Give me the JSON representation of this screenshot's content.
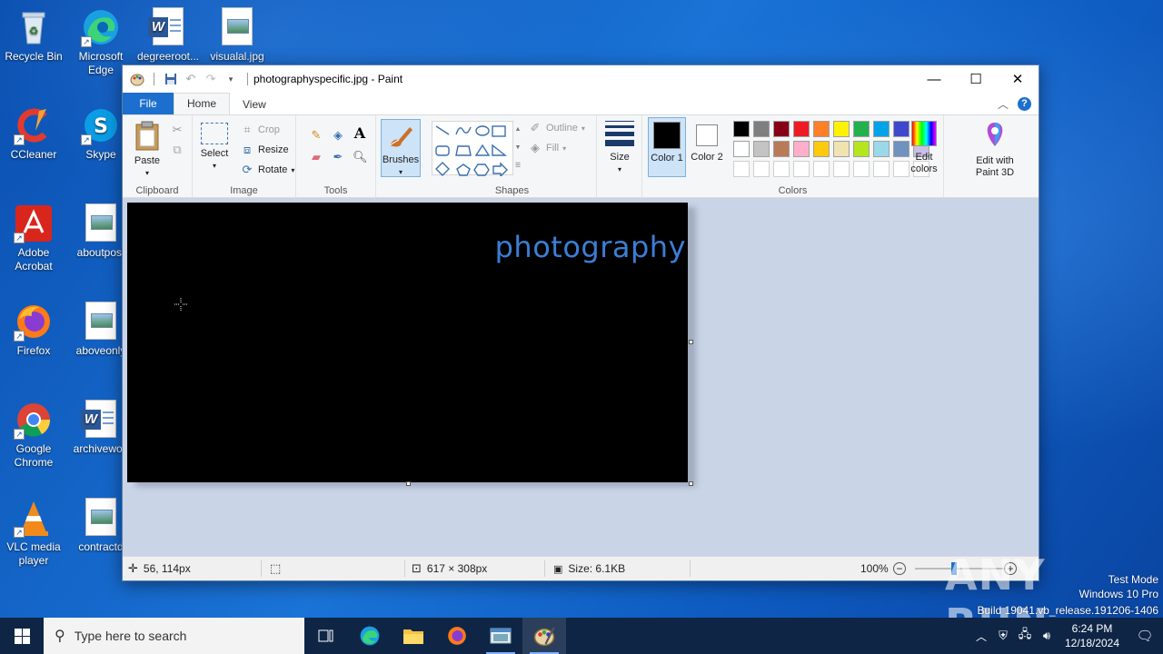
{
  "desktop": {
    "icons": [
      {
        "label": "Recycle Bin",
        "icon": "recycle-bin-icon"
      },
      {
        "label": "Microsoft Edge",
        "icon": "edge-icon"
      },
      {
        "label": "degreeroot...",
        "icon": "word-doc-icon"
      },
      {
        "label": "visualal.jpg",
        "icon": "image-file-icon"
      },
      {
        "label": "CCleaner",
        "icon": "ccleaner-icon"
      },
      {
        "label": "Skype",
        "icon": "skype-icon"
      },
      {
        "label": "Adobe Acrobat",
        "icon": "acrobat-icon"
      },
      {
        "label": "aboutpost",
        "icon": "image-file-icon"
      },
      {
        "label": "Firefox",
        "icon": "firefox-icon"
      },
      {
        "label": "aboveonly",
        "icon": "image-file-icon"
      },
      {
        "label": "Google Chrome",
        "icon": "chrome-icon"
      },
      {
        "label": "archivewou",
        "icon": "word-doc-icon"
      },
      {
        "label": "VLC media player",
        "icon": "vlc-icon"
      },
      {
        "label": "contractd",
        "icon": "image-file-icon"
      }
    ]
  },
  "paint": {
    "title": "photographyspecific.jpg - Paint",
    "tabs": {
      "file": "File",
      "home": "Home",
      "view": "View"
    },
    "clipboard": {
      "label": "Clipboard",
      "paste": "Paste"
    },
    "image": {
      "label": "Image",
      "select": "Select",
      "crop": "Crop",
      "resize": "Resize",
      "rotate": "Rotate"
    },
    "tools": {
      "label": "Tools"
    },
    "brushes": "Brushes",
    "shapes": {
      "label": "Shapes",
      "outline": "Outline",
      "fill": "Fill"
    },
    "size": "Size",
    "colors": {
      "label": "Colors",
      "color1": "Color 1",
      "color2": "Color 2",
      "edit_colors": "Edit colors",
      "edit_3d": "Edit with Paint 3D",
      "color1_value": "#000000",
      "color2_value": "#ffffff",
      "palette_row1": [
        "#000000",
        "#7f7f7f",
        "#880015",
        "#ed1c24",
        "#ff7f27",
        "#fff200",
        "#22b14c",
        "#00a2e8",
        "#3f48cc",
        "#a349a4"
      ],
      "palette_row2": [
        "#ffffff",
        "#c3c3c3",
        "#b97a57",
        "#ffaec9",
        "#ffc90e",
        "#efe4b0",
        "#b5e61d",
        "#99d9ea",
        "#7092be",
        "#c8bfe7"
      ],
      "palette_row3": [
        "#ffffff",
        "#ffffff",
        "#ffffff",
        "#ffffff",
        "#ffffff",
        "#ffffff",
        "#ffffff",
        "#ffffff",
        "#ffffff",
        "#ffffff"
      ]
    },
    "canvas_text": "photography",
    "status": {
      "cursor_pos": "56, 114px",
      "dimensions": "617 × 308px",
      "size": "Size: 6.1KB",
      "zoom": "100%"
    }
  },
  "taskbar": {
    "search_placeholder": "Type here to search",
    "time": "6:24 PM",
    "date": "12/18/2024"
  },
  "watermark": {
    "line1": "Test Mode",
    "line2": "Windows 10 Pro",
    "line3": "Build 19041.vb_release.191206-1406",
    "brand": "ANY RUN"
  }
}
